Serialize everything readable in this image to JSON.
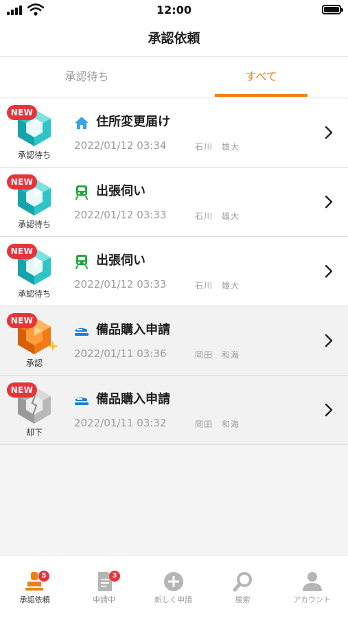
{
  "status_bar": {
    "time": "12:00"
  },
  "header": {
    "title": "承認依頼"
  },
  "tabs": [
    {
      "label": "承認待ち",
      "active": false
    },
    {
      "label": "すべて",
      "active": true
    }
  ],
  "items": [
    {
      "badge": "NEW",
      "status": "承認待ち",
      "category_icon": "house-icon",
      "title": "住所変更届け",
      "datetime": "2022/01/12 03:34",
      "person": "石川　雄大"
    },
    {
      "badge": "NEW",
      "status": "承認待ち",
      "category_icon": "train-icon",
      "title": "出張伺い",
      "datetime": "2022/01/12 03:33",
      "person": "石川　雄大"
    },
    {
      "badge": "NEW",
      "status": "承認待ち",
      "category_icon": "train-icon",
      "title": "出張伺い",
      "datetime": "2022/01/12 03:33",
      "person": "石川　雄大"
    },
    {
      "badge": "NEW",
      "status": "承認",
      "category_icon": "stapler-icon",
      "title": "備品購入申請",
      "datetime": "2022/01/11 03:36",
      "person": "岡田　和海"
    },
    {
      "badge": "NEW",
      "status": "却下",
      "category_icon": "stapler-icon",
      "title": "備品購入申請",
      "datetime": "2022/01/11 03:32",
      "person": "岡田　和海"
    }
  ],
  "bottom_nav": [
    {
      "label": "承認依頼",
      "icon": "stamp-icon",
      "badge": "5",
      "active": true
    },
    {
      "label": "申請中",
      "icon": "document-icon",
      "badge": "3",
      "active": false
    },
    {
      "label": "新しく申請",
      "icon": "plus-circle-icon",
      "active": false
    },
    {
      "label": "検索",
      "icon": "search-icon",
      "active": false
    },
    {
      "label": "アカウント",
      "icon": "account-icon",
      "active": false
    }
  ],
  "colors": {
    "accent": "#f08012",
    "badge_red": "#e8333a",
    "pending_teal": "#2ec4c8",
    "approved_orange": "#f07a16",
    "rejected_gray": "#b8b8b8"
  }
}
